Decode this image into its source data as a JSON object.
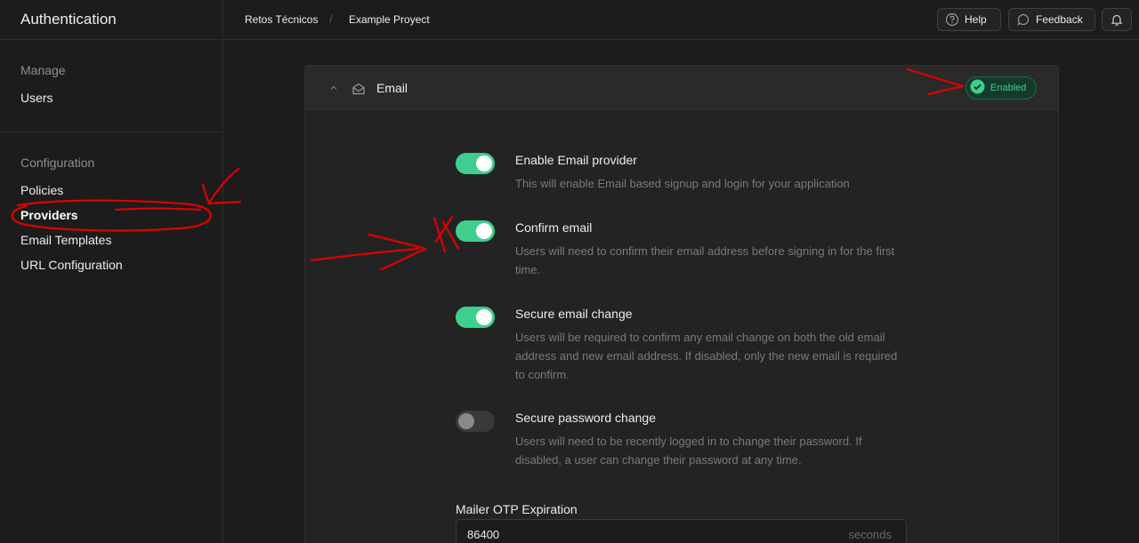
{
  "sidebar": {
    "title": "Authentication",
    "groups": [
      {
        "title": "Manage",
        "items": [
          {
            "label": "Users"
          }
        ]
      },
      {
        "title": "Configuration",
        "items": [
          {
            "label": "Policies"
          },
          {
            "label": "Providers",
            "active": true
          },
          {
            "label": "Email Templates"
          },
          {
            "label": "URL Configuration"
          }
        ]
      }
    ]
  },
  "topbar": {
    "breadcrumb": [
      "Retos Técnicos",
      "Example Proyect"
    ],
    "help_label": "Help",
    "feedback_label": "Feedback"
  },
  "panel": {
    "title": "Email",
    "status_badge": "Enabled",
    "settings": [
      {
        "title": "Enable Email provider",
        "description": "This will enable Email based signup and login for your application",
        "enabled": true
      },
      {
        "title": "Confirm email",
        "description": "Users will need to confirm their email address before signing in for the first time.",
        "enabled": true
      },
      {
        "title": "Secure email change",
        "description": "Users will be required to confirm any email change on both the old email address and new email address. If disabled, only the new email is required to confirm.",
        "enabled": true
      },
      {
        "title": "Secure password change",
        "description": "Users will need to be recently logged in to change their password. If disabled, a user can change their password at any time.",
        "enabled": false
      }
    ],
    "otp_field": {
      "label": "Mailer OTP Expiration",
      "value": "86400",
      "suffix": "seconds"
    }
  },
  "colors": {
    "accent": "#3ecf8e",
    "annotation": "#e00000",
    "background": "#1c1c1c"
  }
}
